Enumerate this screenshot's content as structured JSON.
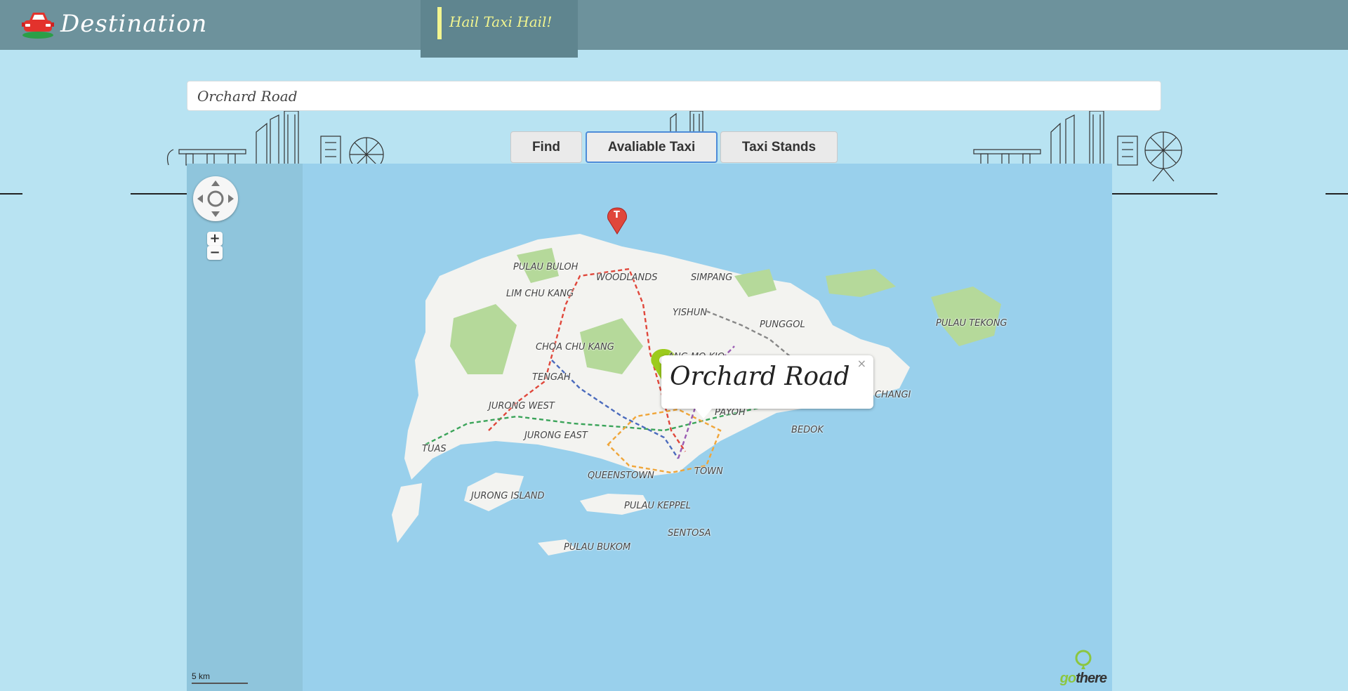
{
  "header": {
    "brand_title": "Destination",
    "nav_tab_label": "Hail Taxi Hail!"
  },
  "search": {
    "value": "Orchard Road"
  },
  "buttons": {
    "find": "Find",
    "available_taxi": "Avaliable Taxi",
    "taxi_stands": "Taxi Stands"
  },
  "map": {
    "popup_text": "Orchard Road",
    "popup_close": "×",
    "scale_label": "5 km",
    "zoom_in": "+",
    "zoom_out": "−",
    "taxi_marker_letter": "T",
    "attribution": {
      "go": "go",
      "there": "there"
    },
    "labels": [
      "PULAU BULOH",
      "WOODLANDS",
      "SIMPANG",
      "LIM CHU KANG",
      "YISHUN",
      "PUNGGOL",
      "PULAU TEKONG",
      "CHOA CHU KANG",
      "ANG MO KIO",
      "TENGAH",
      "CHANGI",
      "JURONG WEST",
      "PAYOH",
      "BEDOK",
      "TUAS",
      "JURONG EAST",
      "TOWN",
      "QUEENSTOWN",
      "JURONG ISLAND",
      "PULAU KEPPEL",
      "SENTOSA",
      "PULAU BUKOM"
    ]
  },
  "colors": {
    "header_bg": "#6d929c",
    "page_bg": "#b8e3f2",
    "sea": "#99d0ec",
    "land": "#f3f3f0",
    "park": "#b5d99a",
    "accent_yellow": "#f2f58f",
    "marker_green": "#9ccb1c",
    "marker_red": "#e0473b"
  }
}
